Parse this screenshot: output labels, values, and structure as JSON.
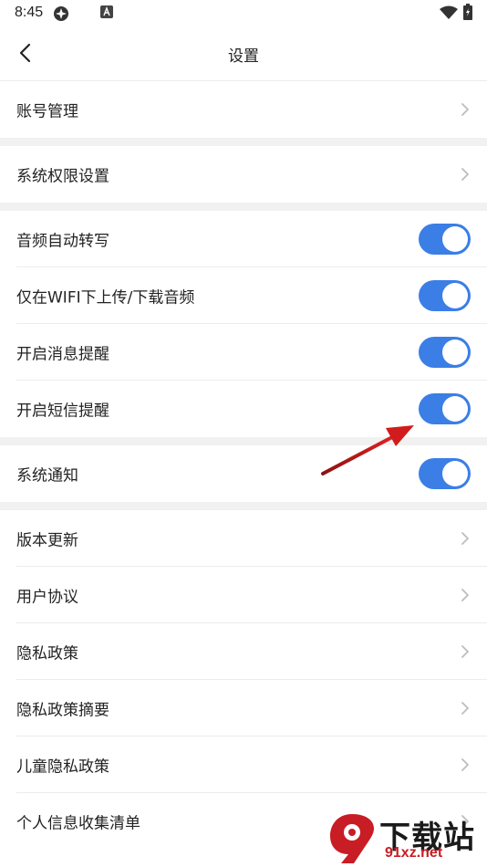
{
  "status_bar": {
    "time": "8:45",
    "icons": [
      "vpn-icon",
      "app-notification-icon",
      "wifi-icon",
      "battery-icon"
    ]
  },
  "app_bar": {
    "title": "设置",
    "back_icon": "chevron-left-icon"
  },
  "sections": [
    {
      "items": [
        {
          "label": "账号管理",
          "type": "link"
        }
      ]
    },
    {
      "items": [
        {
          "label": "系统权限设置",
          "type": "link"
        }
      ]
    },
    {
      "items": [
        {
          "label": "音频自动转写",
          "type": "toggle",
          "on": true
        },
        {
          "label": "仅在WIFI下上传/下载音频",
          "type": "toggle",
          "on": true
        },
        {
          "label": "开启消息提醒",
          "type": "toggle",
          "on": true
        },
        {
          "label": "开启短信提醒",
          "type": "toggle",
          "on": true
        }
      ]
    },
    {
      "items": [
        {
          "label": "系统通知",
          "type": "toggle",
          "on": true
        }
      ]
    },
    {
      "items": [
        {
          "label": "版本更新",
          "type": "link"
        },
        {
          "label": "用户协议",
          "type": "link"
        },
        {
          "label": "隐私政策",
          "type": "link"
        },
        {
          "label": "隐私政策摘要",
          "type": "link"
        },
        {
          "label": "儿童隐私政策",
          "type": "link"
        },
        {
          "label": "个人信息收集清单",
          "type": "link"
        }
      ]
    }
  ],
  "colors": {
    "toggle_on": "#3b7ee6",
    "section_gap": "#f1f1f1",
    "annotation_arrow": "#d01c1c"
  },
  "watermark": {
    "logo_text": "下载站",
    "url": "91xz.net"
  }
}
